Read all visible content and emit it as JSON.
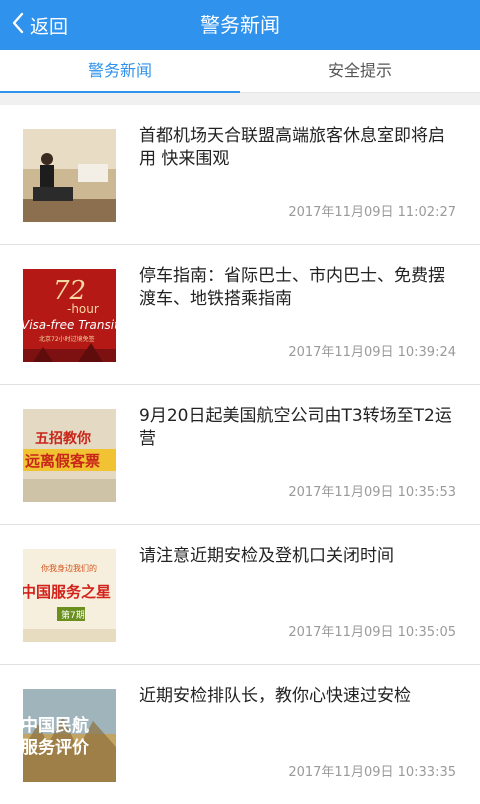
{
  "header": {
    "back_label": "返回",
    "title": "警务新闻"
  },
  "tabs": [
    {
      "label": "警务新闻",
      "active": true
    },
    {
      "label": "安全提示",
      "active": false
    }
  ],
  "news": [
    {
      "title": "首都机场天合联盟高端旅客休息室即将启用 快来围观",
      "time": "2017年11月09日 11:02:27"
    },
    {
      "title": "停车指南：省际巴士、市内巴士、免费摆渡车、地铁搭乘指南",
      "time": "2017年11月09日 10:39:24",
      "thumb_text": {
        "big": "72",
        "hour": "-hour",
        "visa": "Visa-free Transit",
        "sub": "北京72小时过境免签"
      }
    },
    {
      "title": "9月20日起美国航空公司由T3转场至T2运营",
      "time": "2017年11月09日 10:35:53",
      "thumb_text": {
        "line1": "五招教你",
        "line2": "远离假客票"
      }
    },
    {
      "title": "请注意近期安检及登机口关闭时间",
      "time": "2017年11月09日 10:35:05",
      "thumb_text": {
        "line1": "你我身边我们的",
        "line2": "中国服务之星",
        "badge": "第7期"
      }
    },
    {
      "title": "近期安检排队长，教你心快速过安检",
      "time": "2017年11月09日 10:33:35",
      "thumb_text": {
        "line1": "中国民航",
        "line2": "服务评价"
      }
    }
  ],
  "colors": {
    "accent": "#2f92ec",
    "muted": "#9a9a9a"
  }
}
